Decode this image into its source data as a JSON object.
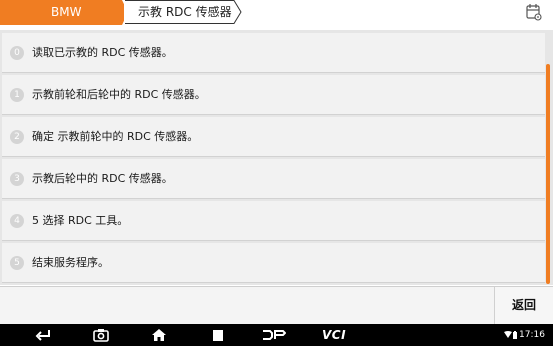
{
  "breadcrumb": {
    "parent": "BMW",
    "current": "示教 RDC 传感器"
  },
  "colors": {
    "accent": "#f07d22",
    "list_bg": "#f2f2f2",
    "badge": "#d4d4d4"
  },
  "steps": [
    {
      "num": "0",
      "text": "读取已示教的 RDC 传感器。"
    },
    {
      "num": "1",
      "text": "示教前轮和后轮中的 RDC 传感器。"
    },
    {
      "num": "2",
      "text": "确定 示教前轮中的 RDC 传感器。"
    },
    {
      "num": "3",
      "text": "示教后轮中的 RDC 传感器。"
    },
    {
      "num": "4",
      "text": "5 选择 RDC 工具。"
    },
    {
      "num": "5",
      "text": "结束服务程序。"
    }
  ],
  "footer": {
    "back_label": "返回"
  },
  "navbar": {
    "icons": [
      "back-arrow-icon",
      "camera-icon",
      "home-icon",
      "recent-apps-icon",
      "dp-logo-icon",
      "vci-logo-icon"
    ],
    "vci_label": "VCI",
    "time": "17:16"
  }
}
